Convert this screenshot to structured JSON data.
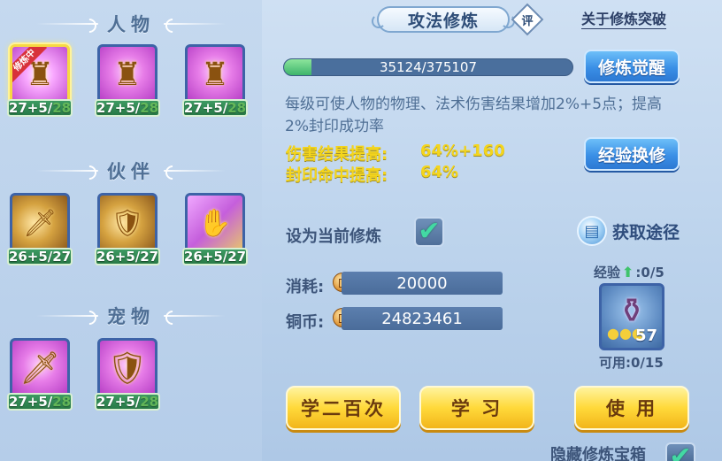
{
  "left_panel": {
    "sections": [
      {
        "title": "人物"
      },
      {
        "title": "伙伴"
      },
      {
        "title": "宠物"
      }
    ],
    "character_skills": [
      {
        "icon": "armored-warrior-icon",
        "glyph": "♜",
        "level": "27+5/",
        "max": "28",
        "tag": "修炼中",
        "selected": true
      },
      {
        "icon": "armored-warrior-icon",
        "glyph": "♜",
        "level": "27+5/",
        "max": "28"
      },
      {
        "icon": "armored-warrior-icon",
        "glyph": "♜",
        "level": "27+5/",
        "max": "28"
      }
    ],
    "partner_skills": [
      {
        "icon": "lion-sword-icon",
        "glyph": "🗡",
        "level": "26+5/27"
      },
      {
        "icon": "lion-shield-icon",
        "glyph": "🛡",
        "level": "26+5/27"
      },
      {
        "icon": "lion-hand-icon",
        "glyph": "✋",
        "level": "26+5/27"
      }
    ],
    "pet_skills": [
      {
        "icon": "cat-sword-icon",
        "glyph": "🗡",
        "level": "27+5/",
        "max": "28"
      },
      {
        "icon": "cat-shield-icon",
        "glyph": "🛡",
        "level": "27+5/",
        "max": "28"
      }
    ]
  },
  "header": {
    "title": "攻法修炼",
    "rate_badge": "评",
    "breakthrough_link": "关于修炼突破"
  },
  "progress": {
    "current": 35124,
    "max": 375107,
    "text": "35124/375107",
    "fraction": 0.0936
  },
  "buttons": {
    "awaken": "修炼觉醒",
    "exchange": "经验换修",
    "learn_200": "学二百次",
    "learn": "学 习",
    "use": "使 用"
  },
  "description": "每级可使人物的物理、法术伤害结果增加2%+5点；提高2%封印成功率",
  "effects": [
    {
      "label": "伤害结果提高:",
      "value": "64%+160"
    },
    {
      "label": "封印命中提高:",
      "value": "64%"
    }
  ],
  "set_current": {
    "label": "设为当前修炼",
    "checked": true
  },
  "get_path": {
    "label": "获取途径",
    "icon": "book-icon"
  },
  "costs": {
    "consume_label": "消耗:",
    "consume_value": "20000",
    "copper_label": "铜币:",
    "copper_value": "24823461"
  },
  "item": {
    "exp_label": "经验",
    "exp_value": ":0/5",
    "count": "57",
    "usable": "可用:0/15",
    "icon": "vase-icon"
  },
  "hide_chest": {
    "label": "隐藏修炼宝箱",
    "checked": true
  },
  "colors": {
    "accent_yellow": "#f4d51c",
    "panel_blue": "#bcd3ec",
    "button_blue": "#3a8fe6",
    "button_yellow": "#ffd93a",
    "level_green": "#287a47"
  }
}
